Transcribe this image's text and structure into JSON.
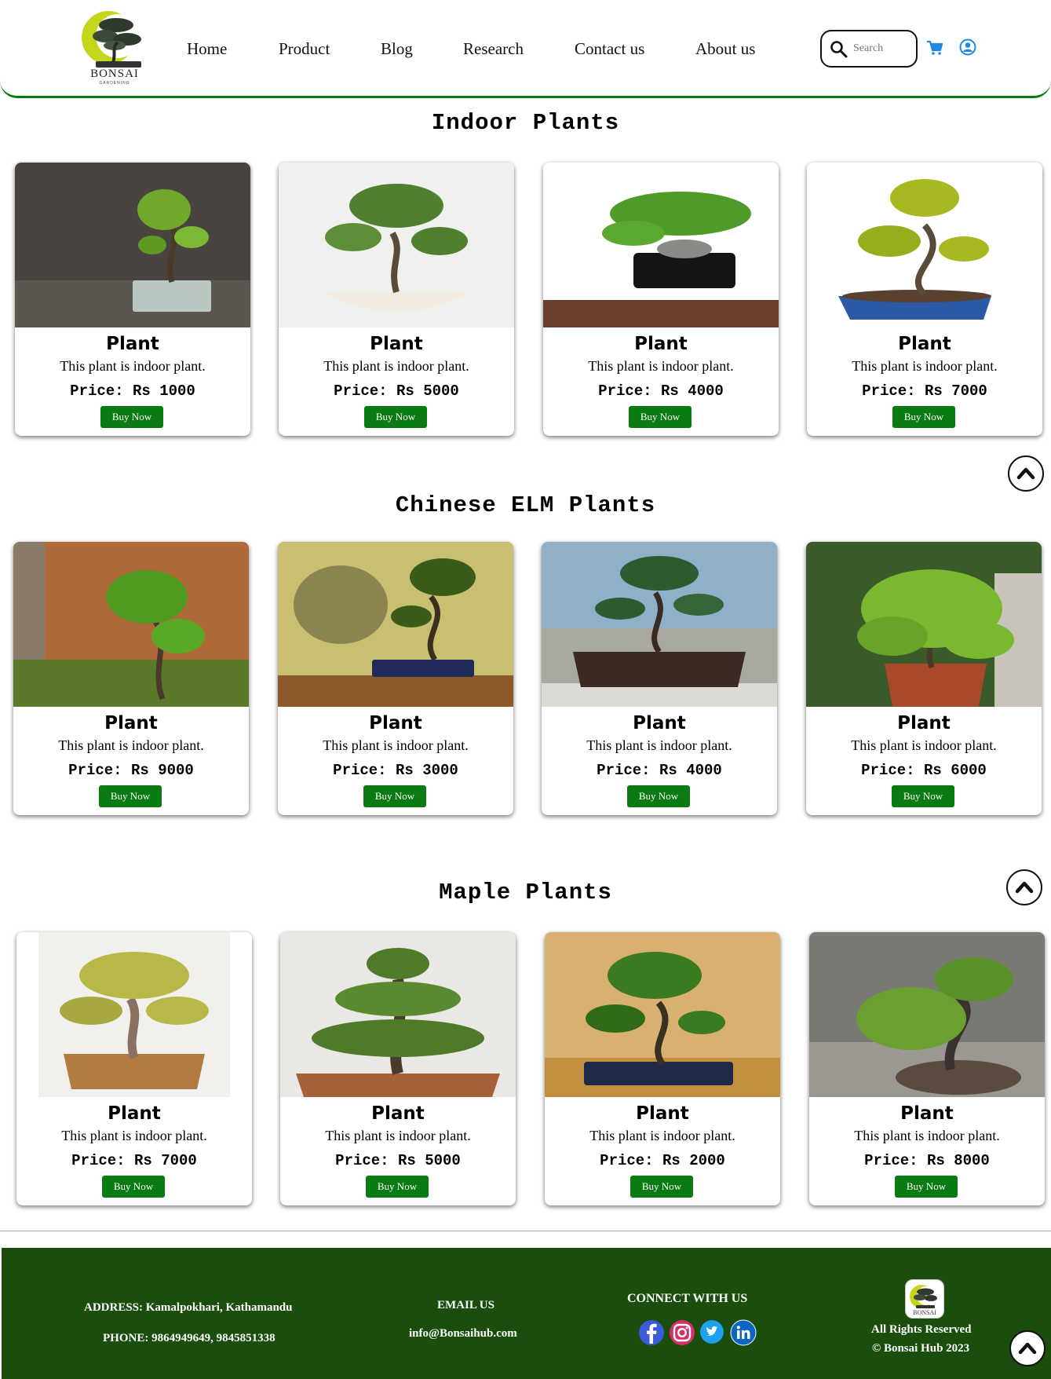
{
  "brand": {
    "name": "BONSAI",
    "tagline": "GARDENING"
  },
  "nav": [
    "Home",
    "Product",
    "Blog",
    "Research",
    "Contact us",
    "About us"
  ],
  "search": {
    "placeholder": "Search"
  },
  "sections": [
    {
      "title": "Indoor Plants",
      "cards": [
        {
          "name": "Plant",
          "desc": "This plant is indoor plant.",
          "price": "Price: Rs 1000",
          "button": "Buy Now"
        },
        {
          "name": "Plant",
          "desc": "This plant is indoor plant.",
          "price": "Price: Rs 5000",
          "button": "Buy Now"
        },
        {
          "name": "Plant",
          "desc": "This plant is indoor plant.",
          "price": "Price: Rs 4000",
          "button": "Buy Now"
        },
        {
          "name": "Plant",
          "desc": "This plant is indoor plant.",
          "price": "Price: Rs 7000",
          "button": "Buy Now"
        }
      ]
    },
    {
      "title": "Chinese ELM Plants",
      "cards": [
        {
          "name": "Plant",
          "desc": "This plant is indoor plant.",
          "price": "Price: Rs 9000",
          "button": "Buy Now"
        },
        {
          "name": "Plant",
          "desc": "This plant is indoor plant.",
          "price": "Price: Rs 3000",
          "button": "Buy Now"
        },
        {
          "name": "Plant",
          "desc": "This plant is indoor plant.",
          "price": "Price: Rs 4000",
          "button": "Buy Now"
        },
        {
          "name": "Plant",
          "desc": "This plant is indoor plant.",
          "price": "Price: Rs 6000",
          "button": "Buy Now"
        }
      ]
    },
    {
      "title": "Maple Plants",
      "cards": [
        {
          "name": "Plant",
          "desc": "This plant is indoor plant.",
          "price": "Price: Rs 7000",
          "button": "Buy Now"
        },
        {
          "name": "Plant",
          "desc": "This plant is indoor plant.",
          "price": "Price: Rs 5000",
          "button": "Buy Now"
        },
        {
          "name": "Plant",
          "desc": "This plant is indoor plant.",
          "price": "Price: Rs 2000",
          "button": "Buy Now"
        },
        {
          "name": "Plant",
          "desc": "This plant is indoor plant.",
          "price": "Price: Rs 8000",
          "button": "Buy Now"
        }
      ]
    }
  ],
  "footer": {
    "address": "ADDRESS: Kamalpokhari, Kathamandu",
    "phone": "PHONE: 9864949649, 9845851338",
    "email_title": "EMAIL US",
    "email": "info@Bonsaihub.com",
    "connect_title": "CONNECT WITH US",
    "rights": "All Rights Reserved",
    "copyright": "© Bonsai Hub 2023",
    "logo_text": "BONSAI"
  },
  "colors": {
    "accent": "#0a7a12",
    "footer_bg": "#1b4d0c",
    "icon_blue": "#1e88e5"
  }
}
